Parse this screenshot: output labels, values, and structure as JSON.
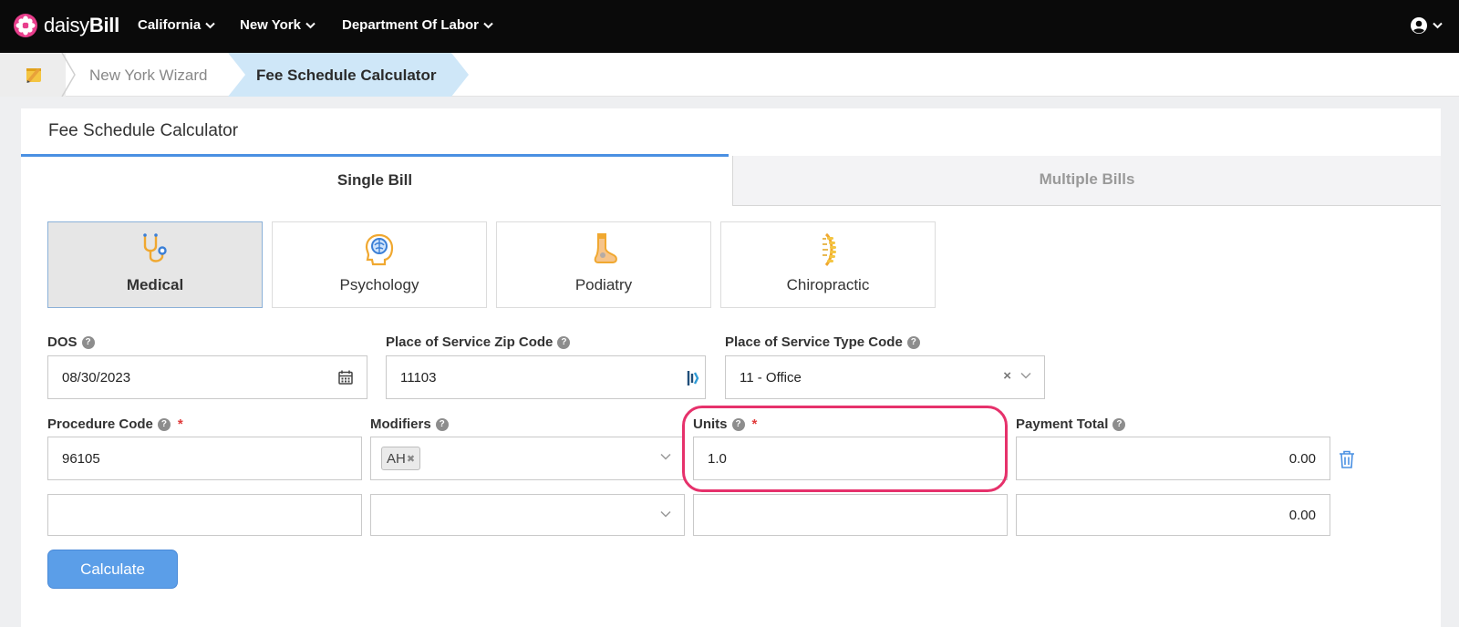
{
  "app": {
    "brand_prefix": "daisy",
    "brand_suffix": "Bill"
  },
  "nav": {
    "items": [
      {
        "label": "California"
      },
      {
        "label": "New York"
      },
      {
        "label": "Department Of Labor"
      }
    ]
  },
  "breadcrumb": {
    "items": [
      "New York Wizard",
      "Fee Schedule Calculator"
    ]
  },
  "card": {
    "title": "Fee Schedule Calculator"
  },
  "tabs": {
    "single": "Single Bill",
    "multiple": "Multiple Bills",
    "active": "single"
  },
  "specialties": [
    {
      "label": "Medical",
      "icon": "stethoscope-icon",
      "active": true
    },
    {
      "label": "Psychology",
      "icon": "brain-head-icon",
      "active": false
    },
    {
      "label": "Podiatry",
      "icon": "foot-icon",
      "active": false
    },
    {
      "label": "Chiropractic",
      "icon": "spine-icon",
      "active": false
    }
  ],
  "form": {
    "dos": {
      "label": "DOS",
      "value": "08/30/2023"
    },
    "zip": {
      "label": "Place of Service Zip Code",
      "value": "11103"
    },
    "pos_type": {
      "label": "Place of Service Type Code",
      "value": "11 - Office"
    },
    "procedure": {
      "label": "Procedure Code",
      "required": "*"
    },
    "modifiers": {
      "label": "Modifiers"
    },
    "units": {
      "label": "Units",
      "required": "*"
    },
    "payment": {
      "label": "Payment Total"
    },
    "rows": [
      {
        "procedure": "96105",
        "modifier_chip": "AH",
        "units": "1.0",
        "payment": "0.00"
      },
      {
        "procedure": "",
        "modifier_chip": "",
        "units": "",
        "payment": "0.00"
      }
    ],
    "calculate_label": "Calculate"
  },
  "colors": {
    "accent": "#4a90e2",
    "button": "#5b9ee8",
    "highlight": "#e6316b",
    "required": "#e03a3a",
    "topbar": "#0a0a0a",
    "breadcrumb_active": "#cfe7f8"
  }
}
